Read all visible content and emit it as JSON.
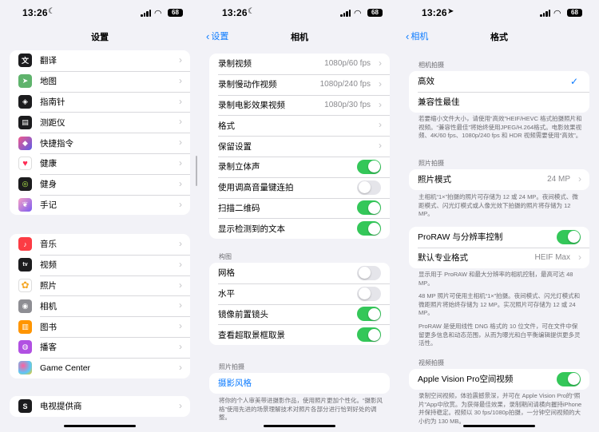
{
  "status_bar": {
    "time": "13:26",
    "battery": "68"
  },
  "panel1": {
    "title": "设置",
    "group1": [
      {
        "label": "翻译",
        "icon": "translate-icon",
        "color": "#1c1c1e"
      },
      {
        "label": "地图",
        "icon": "maps-icon",
        "color": "#5fb36c"
      },
      {
        "label": "指南针",
        "icon": "compass-icon",
        "color": "#1c1c1e"
      },
      {
        "label": "测距仪",
        "icon": "measure-icon",
        "color": "#1c1c1e"
      },
      {
        "label": "快捷指令",
        "icon": "shortcuts-icon",
        "color": "#5e5ce6"
      },
      {
        "label": "健康",
        "icon": "health-icon",
        "color": "#ffffff"
      },
      {
        "label": "健身",
        "icon": "fitness-icon",
        "color": "#1c1c1e"
      },
      {
        "label": "手记",
        "icon": "journal-icon",
        "color": "#7d5cf0"
      }
    ],
    "group2": [
      {
        "label": "音乐",
        "icon": "music-icon",
        "color": "#fc3c44"
      },
      {
        "label": "视频",
        "icon": "tv-icon",
        "color": "#1c1c1e"
      },
      {
        "label": "照片",
        "icon": "photos-icon",
        "color": "#ffffff"
      },
      {
        "label": "相机",
        "icon": "camera-icon",
        "color": "#8e8e93"
      },
      {
        "label": "图书",
        "icon": "books-icon",
        "color": "#ff9500"
      },
      {
        "label": "播客",
        "icon": "podcasts-icon",
        "color": "#b150e2"
      },
      {
        "label": "Game Center",
        "icon": "game-center-icon",
        "color": "#ffffff"
      }
    ],
    "group3": [
      {
        "label": "电视提供商",
        "icon": "tv-provider-icon",
        "color": "#1c1c1e"
      }
    ]
  },
  "panel2": {
    "back": "设置",
    "title": "相机",
    "group1": [
      {
        "label": "录制视频",
        "value": "1080p/60 fps",
        "kind": "nav"
      },
      {
        "label": "录制慢动作视频",
        "value": "1080p/240 fps",
        "kind": "nav"
      },
      {
        "label": "录制电影效果视频",
        "value": "1080p/30 fps",
        "kind": "nav"
      },
      {
        "label": "格式",
        "value": "",
        "kind": "nav"
      },
      {
        "label": "保留设置",
        "value": "",
        "kind": "nav"
      },
      {
        "label": "录制立体声",
        "kind": "toggle",
        "on": true
      },
      {
        "label": "使用调高音量键连拍",
        "kind": "toggle",
        "on": false
      },
      {
        "label": "扫描二维码",
        "kind": "toggle",
        "on": true
      },
      {
        "label": "显示检测到的文本",
        "kind": "toggle",
        "on": true
      }
    ],
    "composition_header": "构图",
    "group2": [
      {
        "label": "网格",
        "kind": "toggle",
        "on": false
      },
      {
        "label": "水平",
        "kind": "toggle",
        "on": false
      },
      {
        "label": "镜像前置镜头",
        "kind": "toggle",
        "on": true
      },
      {
        "label": "查看超取景框取景",
        "kind": "toggle",
        "on": true
      }
    ],
    "photo_header": "照片拍摄",
    "photo_style_link": "摄影风格",
    "photo_style_footer": "将你的个人审美带进摄影作品，使用照片更加个性化。“摄影风格”使用先进的场景理解技术对照片各部分进行恰到好处的调整。"
  },
  "panel3": {
    "back": "相机",
    "title": "格式",
    "capture_header": "相机拍摄",
    "capture_options": [
      {
        "label": "高效",
        "selected": true
      },
      {
        "label": "兼容性最佳",
        "selected": false
      }
    ],
    "capture_footer": "若要缩小文件大小，请使用“高效”HEIF/HEVC 格式拍摄照片和视频。“兼容性最佳”将始终使用JPEG/H.264格式。电影效果视频、4K/60 fps、1080p/240 fps 和 HDR 视频需要使用“高效”。",
    "photo_header": "照片拍摄",
    "photo_mode": {
      "label": "照片模式",
      "value": "24 MP"
    },
    "photo_footer": "主相机“1×”拍摄的照片可存储为 12 或 24 MP。夜间模式、微距模式、闪光灯模式或人像光效下拍摄的照片将存储为 12 MP。",
    "proraw": {
      "label": "ProRAW 与分辨率控制",
      "on": true
    },
    "pro_format": {
      "label": "默认专业格式",
      "value": "HEIF Max"
    },
    "pro_footer_1": "显示用于 ProRAW 和最大分辨率的相机控制，最高可达 48 MP。",
    "pro_footer_2": "48 MP 照片可使用主相机“1×”拍摄。夜间模式、闪光灯模式和微距照片将始终存储为 12 MP。实况照片可存储为 12 或 24 MP。",
    "pro_footer_3": "ProRAW 是使用线性 DNG 格式的 10 位文件，可在文件中保留更多信息和动态范围，从而为曝光和白平衡编辑提供更多灵活性。",
    "video_header": "视频拍摄",
    "vision_pro": {
      "label": "Apple Vision Pro空间视频",
      "on": true
    },
    "video_footer": "录制空间视频，体验震撼景深，并可在 Apple Vision Pro的“照片”App中欣赏。为获得最佳效果，录制期间请横向握持iPhone并保持稳定。视频以 30 fps/1080p拍摄，一分钟空间视频的大小约为 130 MB。"
  }
}
